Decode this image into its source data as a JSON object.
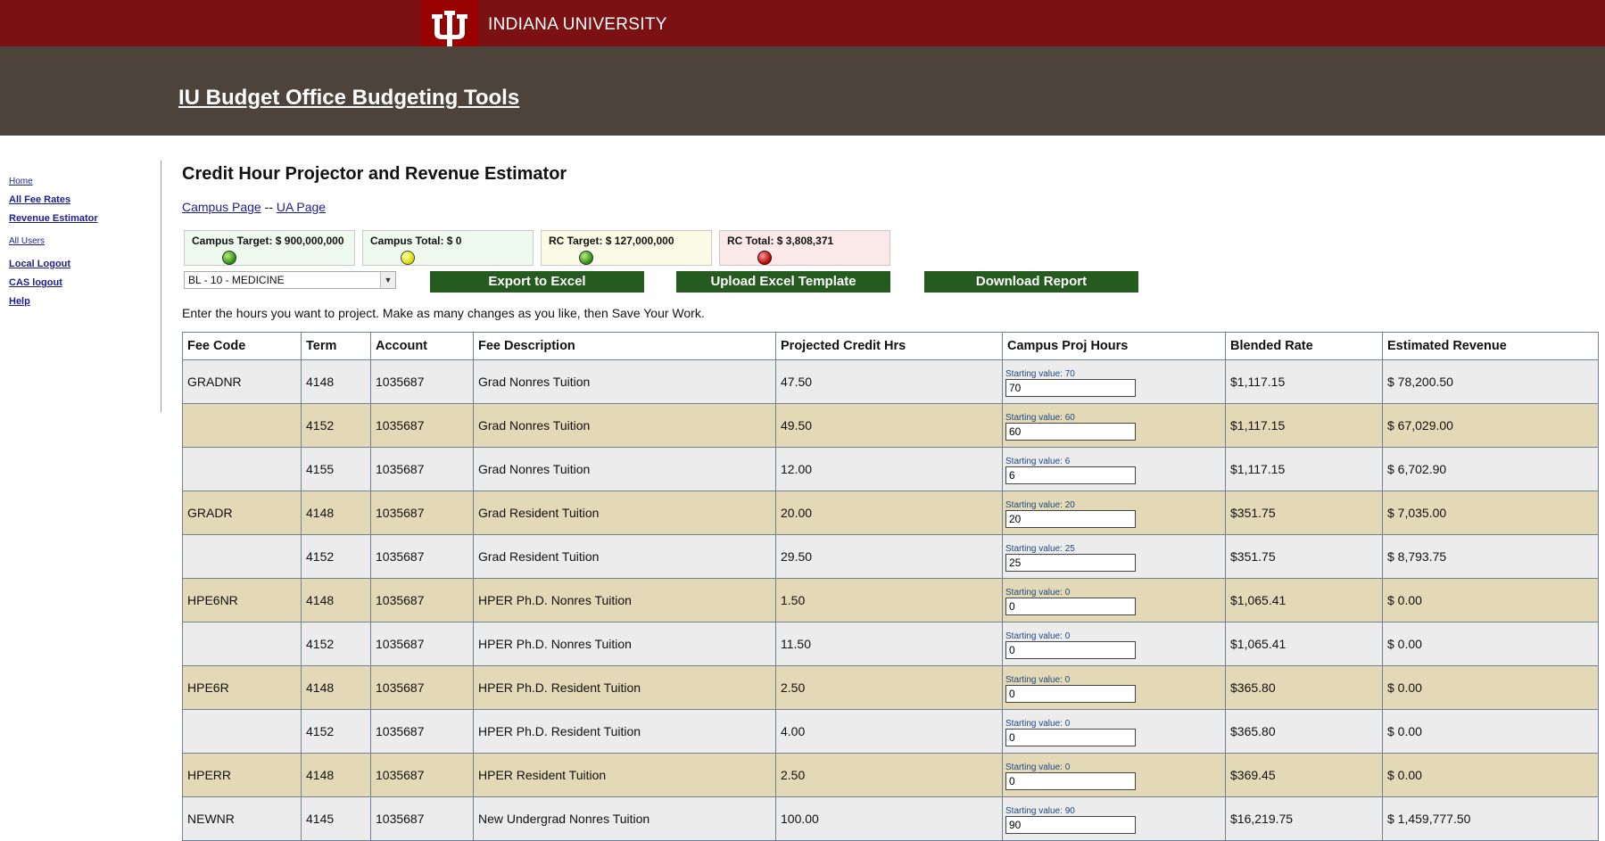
{
  "header": {
    "university": "INDIANA UNIVERSITY",
    "site_title": "IU Budget Office Budgeting Tools"
  },
  "sidebar": {
    "items": [
      {
        "label": "Home"
      },
      {
        "label": "All Fee Rates"
      },
      {
        "label": "Revenue Estimator"
      },
      {
        "label": "All Users"
      },
      {
        "label": "Local Logout"
      },
      {
        "label": "CAS logout"
      },
      {
        "label": "Help"
      }
    ]
  },
  "main": {
    "title": "Credit Hour Projector and Revenue Estimator",
    "campus_link": "Campus Page",
    "separator": "--",
    "ua_link": "UA Page",
    "statuses": [
      {
        "label": "Campus Target: $ 900,000,000",
        "indicator": "green",
        "bg": "#eefaee"
      },
      {
        "label": "Campus Total: $ 0",
        "indicator": "yellow",
        "bg": "#eefaee"
      },
      {
        "label": "RC Target: $ 127,000,000",
        "indicator": "green",
        "bg": "#fbfbe6"
      },
      {
        "label": "RC Total: $ 3,808,371",
        "indicator": "red",
        "bg": "#fbe9e9"
      }
    ],
    "rc_select": "BL - 10 - MEDICINE",
    "buttons": {
      "export": "Export to Excel",
      "upload": "Upload Excel Template",
      "download": "Download Report"
    },
    "instructions": "Enter the hours you want to project. Make as many changes as you like, then Save Your Work."
  },
  "table": {
    "headers": [
      "Fee Code",
      "Term",
      "Account",
      "Fee Description",
      "Projected Credit Hrs",
      "Campus Proj Hours",
      "Blended Rate",
      "Estimated Revenue"
    ],
    "rows": [
      {
        "fee_code": "GRADNR",
        "term": "4148",
        "account": "1035687",
        "desc": "Grad Nonres Tuition",
        "proj": "47.50",
        "start": "Starting value: 70",
        "input": "70",
        "rate": "$1,117.15",
        "rev": "$ 78,200.50"
      },
      {
        "fee_code": "",
        "term": "4152",
        "account": "1035687",
        "desc": "Grad Nonres Tuition",
        "proj": "49.50",
        "start": "Starting value: 60",
        "input": "60",
        "rate": "$1,117.15",
        "rev": "$ 67,029.00"
      },
      {
        "fee_code": "",
        "term": "4155",
        "account": "1035687",
        "desc": "Grad Nonres Tuition",
        "proj": "12.00",
        "start": "Starting value: 6",
        "input": "6",
        "rate": "$1,117.15",
        "rev": "$ 6,702.90"
      },
      {
        "fee_code": "GRADR",
        "term": "4148",
        "account": "1035687",
        "desc": "Grad Resident Tuition",
        "proj": "20.00",
        "start": "Starting value: 20",
        "input": "20",
        "rate": "$351.75",
        "rev": "$ 7,035.00"
      },
      {
        "fee_code": "",
        "term": "4152",
        "account": "1035687",
        "desc": "Grad Resident Tuition",
        "proj": "29.50",
        "start": "Starting value: 25",
        "input": "25",
        "rate": "$351.75",
        "rev": "$ 8,793.75"
      },
      {
        "fee_code": "HPE6NR",
        "term": "4148",
        "account": "1035687",
        "desc": "HPER Ph.D. Nonres Tuition",
        "proj": "1.50",
        "start": "Starting value: 0",
        "input": "0",
        "rate": "$1,065.41",
        "rev": "$ 0.00"
      },
      {
        "fee_code": "",
        "term": "4152",
        "account": "1035687",
        "desc": "HPER Ph.D. Nonres Tuition",
        "proj": "11.50",
        "start": "Starting value: 0",
        "input": "0",
        "rate": "$1,065.41",
        "rev": "$ 0.00"
      },
      {
        "fee_code": "HPE6R",
        "term": "4148",
        "account": "1035687",
        "desc": "HPER Ph.D. Resident Tuition",
        "proj": "2.50",
        "start": "Starting value: 0",
        "input": "0",
        "rate": "$365.80",
        "rev": "$ 0.00"
      },
      {
        "fee_code": "",
        "term": "4152",
        "account": "1035687",
        "desc": "HPER Ph.D. Resident Tuition",
        "proj": "4.00",
        "start": "Starting value: 0",
        "input": "0",
        "rate": "$365.80",
        "rev": "$ 0.00"
      },
      {
        "fee_code": "HPERR",
        "term": "4148",
        "account": "1035687",
        "desc": "HPER Resident Tuition",
        "proj": "2.50",
        "start": "Starting value: 0",
        "input": "0",
        "rate": "$369.45",
        "rev": "$ 0.00"
      },
      {
        "fee_code": "NEWNR",
        "term": "4145",
        "account": "1035687",
        "desc": "New Undergrad Nonres Tuition",
        "proj": "100.00",
        "start": "Starting value: 90",
        "input": "90",
        "rate": "$16,219.75",
        "rev": "$ 1,459,777.50"
      }
    ]
  },
  "colors": {
    "iu_crimson": "#990000",
    "topbar": "#7b1113",
    "banner": "#4e433a",
    "button_green": "#255b1f",
    "row_tan": "#e3d9b6",
    "row_gray": "#ececec"
  },
  "icons": {
    "logo": "iu-trident-logo",
    "status_indicator": "status-dot-icon",
    "select_arrow": "chevron-down-icon"
  }
}
